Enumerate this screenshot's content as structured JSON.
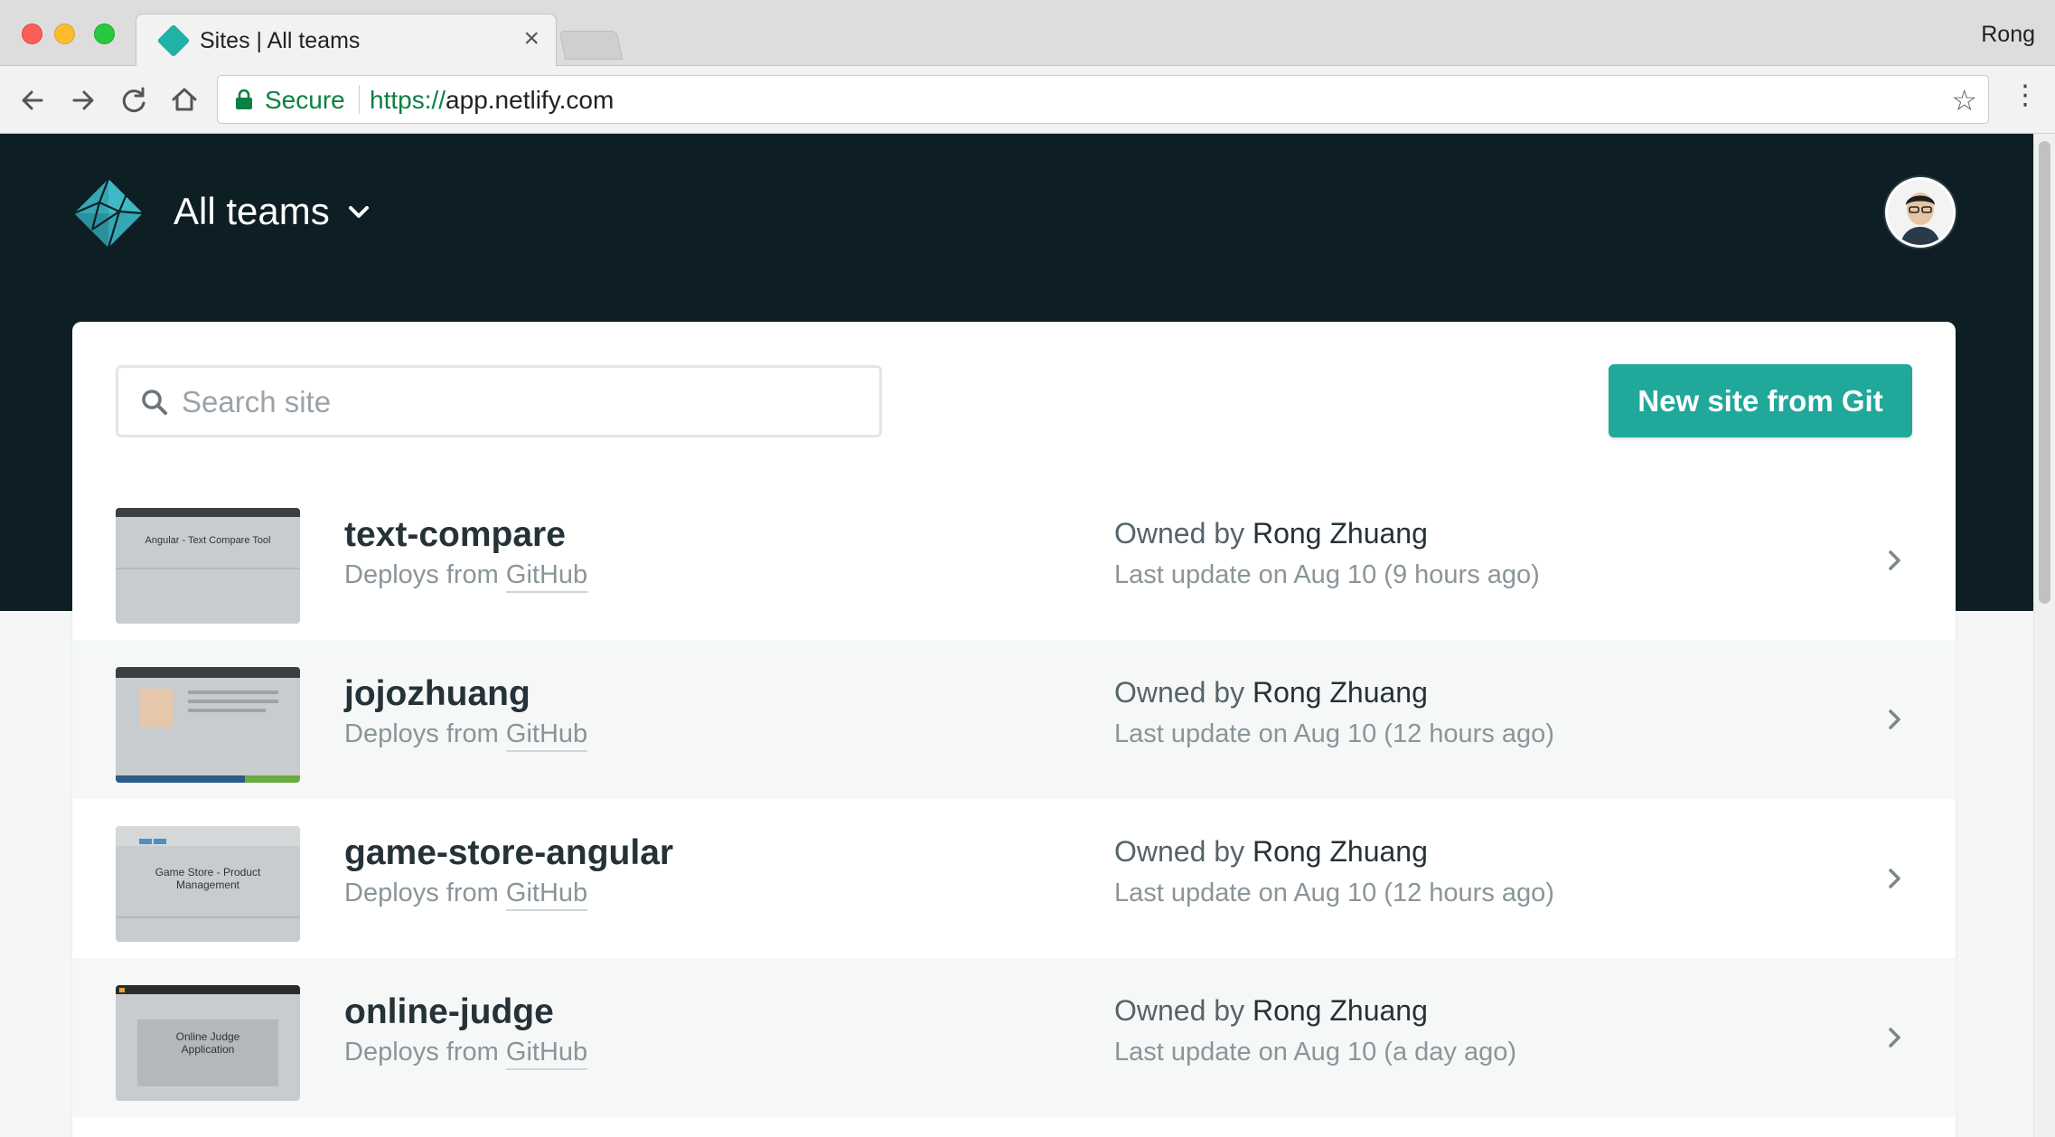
{
  "browser": {
    "tab_title": "Sites | All teams",
    "tab_close": "×",
    "profile_name": "Rong",
    "secure_label": "Secure",
    "url_scheme": "https://",
    "url_host": "app.netlify.com"
  },
  "header": {
    "team_name": "All teams"
  },
  "toolbar": {
    "search_placeholder": "Search site",
    "new_site_label": "New site from Git"
  },
  "sites": [
    {
      "name": "text-compare",
      "deploy_prefix": "Deploys from",
      "provider": "GitHub",
      "owner_prefix": "Owned by",
      "owner": "Rong Zhuang",
      "updated": "Last update on Aug 10 (9 hours ago)",
      "thumb_title": "Angular - Text Compare Tool"
    },
    {
      "name": "jojozhuang",
      "deploy_prefix": "Deploys from",
      "provider": "GitHub",
      "owner_prefix": "Owned by",
      "owner": "Rong Zhuang",
      "updated": "Last update on Aug 10 (12 hours ago)",
      "thumb_title": ""
    },
    {
      "name": "game-store-angular",
      "deploy_prefix": "Deploys from",
      "provider": "GitHub",
      "owner_prefix": "Owned by",
      "owner": "Rong Zhuang",
      "updated": "Last update on Aug 10 (12 hours ago)",
      "thumb_title": "Game Store - Product Management"
    },
    {
      "name": "online-judge",
      "deploy_prefix": "Deploys from",
      "provider": "GitHub",
      "owner_prefix": "Owned by",
      "owner": "Rong Zhuang",
      "updated": "Last update on Aug 10 (a day ago)",
      "thumb_title": "Online Judge Application"
    }
  ],
  "colors": {
    "accent": "#20a89b",
    "hero_bg": "#0e1e25",
    "secure_green": "#0b8043"
  },
  "icons": [
    "back-icon",
    "forward-icon",
    "reload-icon",
    "home-icon",
    "lock-icon",
    "star-icon",
    "menu-icon",
    "netlify-logo-icon",
    "chevron-down-icon",
    "search-icon",
    "chevron-right-icon"
  ]
}
